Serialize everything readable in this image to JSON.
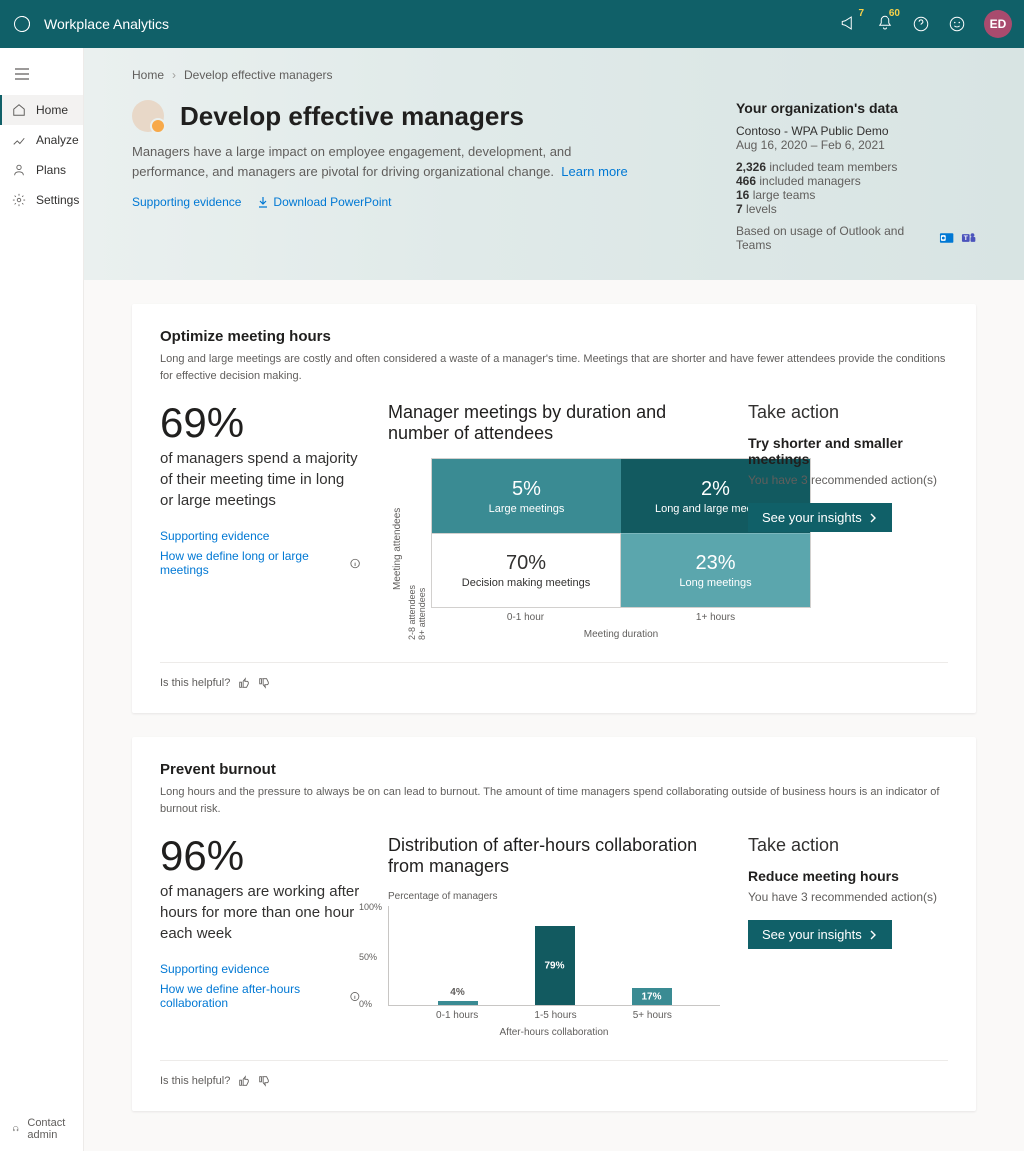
{
  "topbar": {
    "app_name": "Workplace Analytics",
    "megaphone_count": "7",
    "bell_count": "60",
    "avatar_initials": "ED"
  },
  "sidebar": {
    "items": [
      {
        "label": "Home"
      },
      {
        "label": "Analyze"
      },
      {
        "label": "Plans"
      },
      {
        "label": "Settings"
      }
    ],
    "contact_admin": "Contact admin"
  },
  "breadcrumb": {
    "home": "Home",
    "current": "Develop effective managers"
  },
  "hero": {
    "title": "Develop effective managers",
    "desc": "Managers have a large impact on employee engagement, development, and performance, and managers are pivotal for driving organizational change.",
    "learn_more": "Learn more",
    "supporting": "Supporting evidence",
    "download": "Download PowerPoint"
  },
  "org": {
    "heading": "Your organization's data",
    "name": "Contoso - WPA Public Demo",
    "dates": "Aug 16, 2020 – Feb 6, 2021",
    "members_n": "2,326",
    "members_lbl": " included team members",
    "managers_n": "466",
    "managers_lbl": " included managers",
    "teams_n": "16",
    "teams_lbl": " large teams",
    "levels_n": "7",
    "levels_lbl": " levels",
    "based": "Based on usage of Outlook and Teams"
  },
  "card1": {
    "title": "Optimize meeting hours",
    "sub": "Long and large meetings are costly and often considered a waste of a manager's time. Meetings that are shorter and have fewer attendees provide the conditions for effective decision making.",
    "pct": "69%",
    "text": "of managers spend a majority of their meeting time in long or large meetings",
    "supporting": "Supporting evidence",
    "define": "How we define long or large meetings",
    "viz_title": "Manager meetings by duration and number of attendees",
    "y_label": "Meeting attendees",
    "y_tick_top": "8+ attendees",
    "y_tick_bot": "2-8 attendees",
    "x_tick_left": "0-1 hour",
    "x_tick_right": "1+ hours",
    "x_label": "Meeting duration",
    "action_title": "Take action",
    "action_sub": "Try shorter and smaller meetings",
    "action_desc": "You have 3 recommended action(s)",
    "action_btn": "See your insights",
    "helpful": "Is this helpful?"
  },
  "card2": {
    "title": "Prevent burnout",
    "sub": "Long hours and the pressure to always be on can lead to burnout. The amount of time managers spend collaborating outside of business hours is an indicator of burnout risk.",
    "pct": "96%",
    "text": "of managers are working after hours for more than one hour each week",
    "supporting": "Supporting evidence",
    "define": "How we define after-hours collaboration",
    "viz_title": "Distribution of after-hours collaboration from managers",
    "bc_label": "Percentage of managers",
    "x_label": "After-hours collaboration",
    "action_title": "Take action",
    "action_sub": "Reduce meeting hours",
    "action_desc": "You have 3 recommended action(s)",
    "action_btn": "See your insights",
    "helpful": "Is this helpful?"
  },
  "chart_data": {
    "matrix": {
      "type": "heatmap",
      "y_categories": [
        "8+ attendees",
        "2-8 attendees"
      ],
      "x_categories": [
        "0-1 hour",
        "1+ hours"
      ],
      "cells": [
        {
          "pct": "5%",
          "label": "Large meetings"
        },
        {
          "pct": "2%",
          "label": "Long and large meetings"
        },
        {
          "pct": "70%",
          "label": "Decision making meetings"
        },
        {
          "pct": "23%",
          "label": "Long meetings"
        }
      ]
    },
    "bars": {
      "type": "bar",
      "ylabel": "Percentage of managers",
      "ylim": [
        0,
        100
      ],
      "yticks": [
        "100%",
        "50%",
        "0%"
      ],
      "categories": [
        "0-1 hours",
        "1-5 hours",
        "5+ hours"
      ],
      "values": [
        4,
        79,
        17
      ],
      "labels": [
        "4%",
        "79%",
        "17%"
      ],
      "xlabel": "After-hours collaboration"
    }
  }
}
